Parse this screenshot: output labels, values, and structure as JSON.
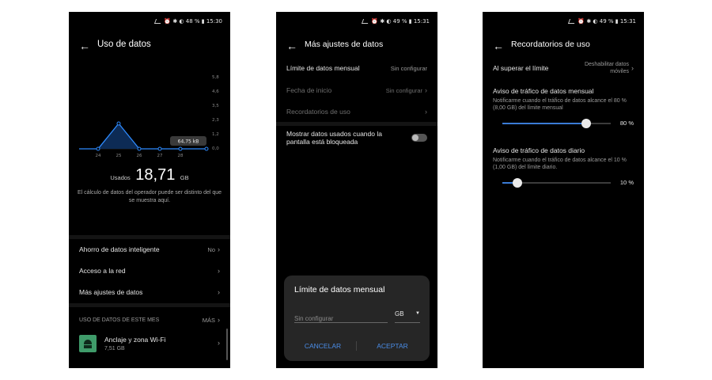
{
  "colors": {
    "accent": "#3a7bd5",
    "chart_line": "#2e8bff"
  },
  "screen1": {
    "status": "⏰ ✱ ◐ 48 % ▮ 15:30",
    "title": "Uso de datos",
    "chart": {
      "y_ticks": [
        "5,8",
        "4,6",
        "3,5",
        "2,3",
        "1,2",
        "0,0"
      ],
      "x_ticks": [
        "24",
        "25",
        "26",
        "27",
        "28"
      ],
      "tooltip": "64,75 kB"
    },
    "usage_label": "Usados",
    "usage_value": "18,71",
    "usage_unit": "GB",
    "note": "El cálculo de datos del operador puede ser distinto del que se muestra aquí.",
    "menu": [
      {
        "label": "Ahorro de datos inteligente",
        "value": "No"
      },
      {
        "label": "Acceso a la red",
        "value": ""
      },
      {
        "label": "Más ajustes de datos",
        "value": ""
      }
    ],
    "section_header": "USO DE DATOS DE ESTE MES",
    "section_more": "MÁS",
    "app": {
      "name": "Anclaje y zona Wi-Fi",
      "size": "7,51 GB"
    }
  },
  "screen2": {
    "status": "⏰ ✱ ◐ 49 % ▮ 15:31",
    "title": "Más ajustes de datos",
    "items": [
      {
        "label": "Límite de datos mensual",
        "value": "Sin configurar"
      },
      {
        "label": "Fecha de inicio",
        "value": "Sin configurar"
      },
      {
        "label": "Recordatorios de uso",
        "value": ""
      }
    ],
    "toggle_label": "Mostrar datos usados cuando la pantalla está bloqueada",
    "dialog": {
      "title": "Límite de datos mensual",
      "placeholder": "Sin configurar",
      "unit": "GB",
      "cancel": "CANCELAR",
      "accept": "ACEPTAR"
    }
  },
  "screen3": {
    "status": "⏰ ✱ ◐ 49 % ▮ 15:31",
    "title": "Recordatorios de uso",
    "limit_row": {
      "label": "Al superar el límite",
      "value": "Deshabilitar datos móviles"
    },
    "monthly": {
      "title": "Aviso de tráfico de datos mensual",
      "desc": "Notificarme cuando el tráfico de datos alcance el 80 % (8,00 GB) del límite mensual",
      "percent_label": "80 %",
      "level": 0.8
    },
    "daily": {
      "title": "Aviso de tráfico de datos diario",
      "desc": "Notificarme cuando el tráfico de datos alcance el 10 % (1,00 GB) del límite diario.",
      "percent_label": "10 %",
      "level": 0.1
    }
  }
}
